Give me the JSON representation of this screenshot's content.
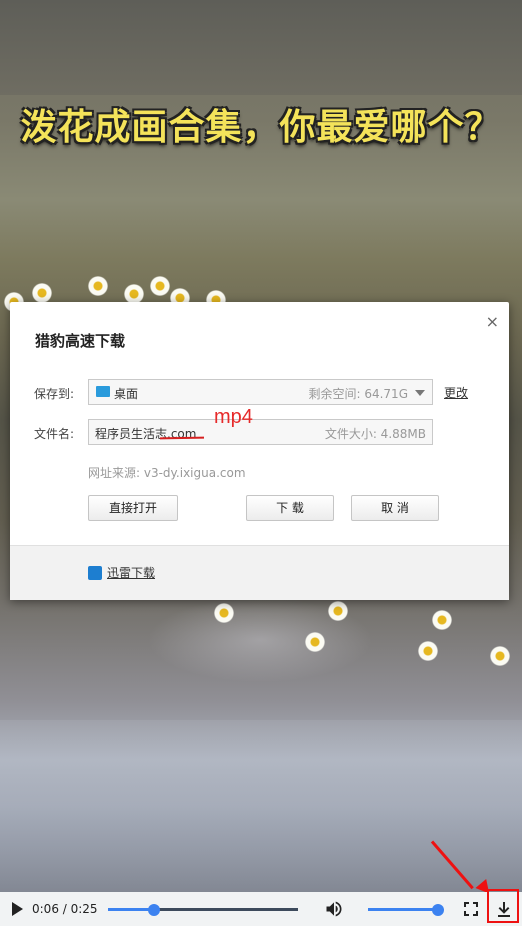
{
  "video": {
    "title": "泼花成画合集，你最爱哪个？"
  },
  "dialog": {
    "title": "猎豹高速下载",
    "close_symbol": "×",
    "save_to_label": "保存到:",
    "save_to_value": "桌面",
    "free_space": "剩余空间: 64.71G",
    "change_label": "更改",
    "filename_label": "文件名:",
    "filename_value": "程序员生活志.com",
    "file_size": "文件大小: 4.88MB",
    "source": "网址来源: v3-dy.ixigua.com",
    "open_direct_label": "直接打开",
    "download_label": "下 载",
    "cancel_label": "取 消",
    "xunlei_label": "迅雷下载"
  },
  "annotation": {
    "text": "mp4",
    "color": "#e62a2a"
  },
  "player": {
    "time": "0:06 / 0:25",
    "progress_fraction": 0.24,
    "volume_fraction": 1.0,
    "accent_color": "#3c82f0"
  }
}
